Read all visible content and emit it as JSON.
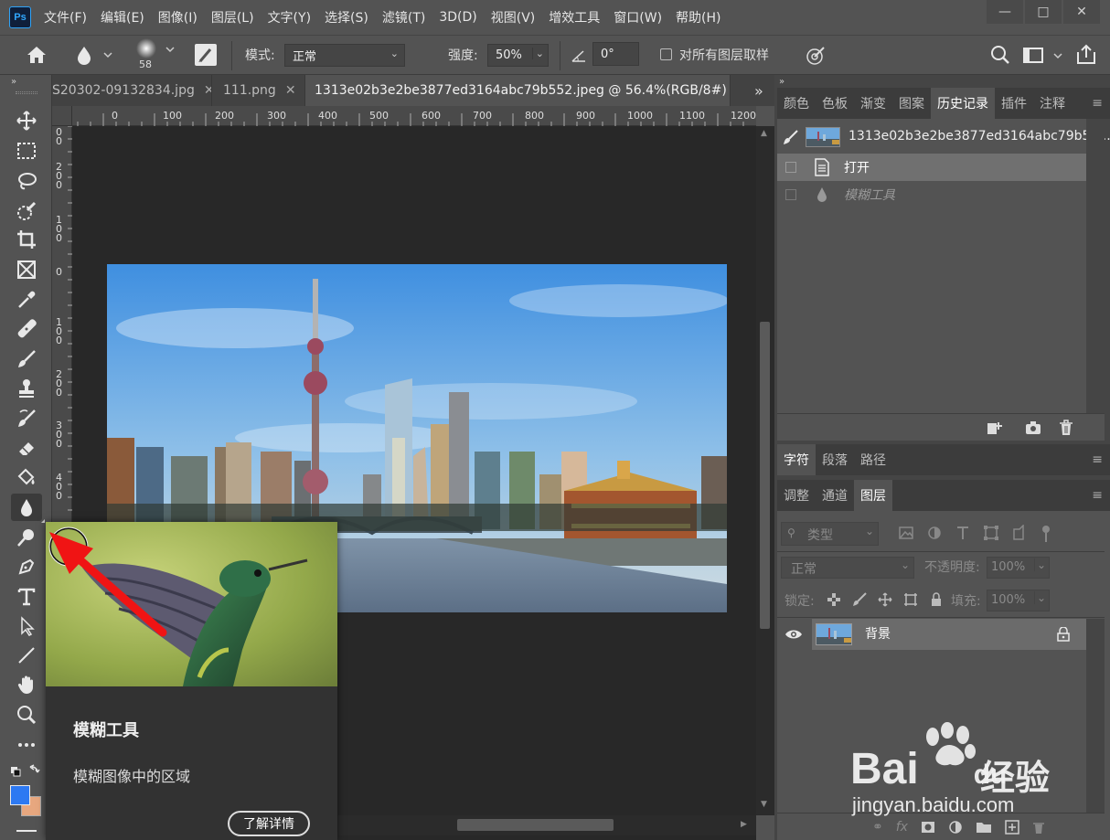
{
  "app": {
    "logo": "Ps"
  },
  "menu": [
    "文件(F)",
    "编辑(E)",
    "图像(I)",
    "图层(L)",
    "文字(Y)",
    "选择(S)",
    "滤镜(T)",
    "3D(D)",
    "视图(V)",
    "增效工具",
    "窗口(W)",
    "帮助(H)"
  ],
  "options": {
    "brush_size": "58",
    "mode_label": "模式:",
    "mode_value": "正常",
    "strength_label": "强度:",
    "strength_value": "50%",
    "angle_value": "0°",
    "sample_all_label": "对所有图层取样"
  },
  "tabs": [
    {
      "label": "S20302-09132834.jpg"
    },
    {
      "label": "111.png"
    },
    {
      "label": "1313e02b3e2be3877ed3164abc79b552.jpeg @ 56.4%(RGB/8#) *"
    }
  ],
  "ruler_top": [
    "0",
    "0",
    "100",
    "200",
    "300",
    "400",
    "500",
    "600",
    "700",
    "800",
    "900",
    "1000",
    "1100",
    "1200"
  ],
  "ruler_left": [
    [
      "0",
      "0"
    ],
    [
      "2",
      "0",
      "0"
    ],
    [
      "1",
      "0",
      "0"
    ],
    [
      "0"
    ],
    [
      "1",
      "0",
      "0"
    ],
    [
      "2",
      "0",
      "0"
    ],
    [
      "3",
      "0",
      "0"
    ],
    [
      "4",
      "0",
      "0"
    ]
  ],
  "panels": {
    "top_tabs": [
      "颜色",
      "色板",
      "渐变",
      "图案",
      "历史记录",
      "插件",
      "注释"
    ],
    "history": {
      "snapshot": "1313e02b3e2be3877ed3164abc79b55...",
      "items": [
        "打开",
        "模糊工具"
      ]
    },
    "mid_tabs": [
      "字符",
      "段落",
      "路径"
    ],
    "layer_tabs": [
      "调整",
      "通道",
      "图层"
    ],
    "layers": {
      "filter_type": "类型",
      "blend_mode": "正常",
      "opacity_label": "不透明度:",
      "opacity_value": "100%",
      "lock_label": "锁定:",
      "fill_label": "填充:",
      "fill_value": "100%",
      "items": [
        {
          "name": "背景"
        }
      ]
    }
  },
  "tooltip": {
    "title": "模糊工具",
    "description": "模糊图像中的区域",
    "button": "了解详情"
  },
  "watermark": {
    "brand": "Bai",
    "brand2": "du",
    "cn": "经验",
    "url": "jingyan.baidu.com"
  }
}
